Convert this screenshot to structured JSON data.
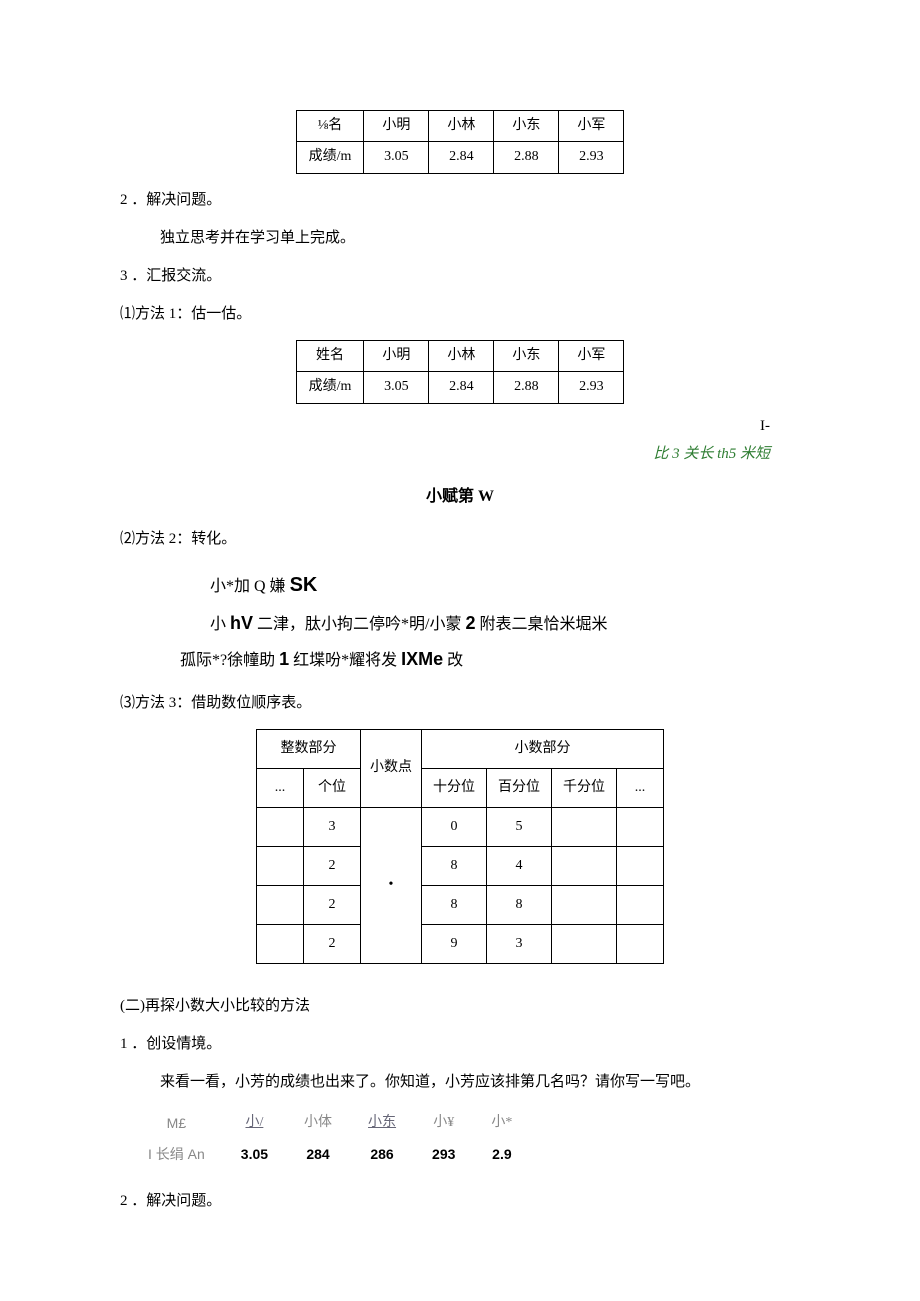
{
  "table1": {
    "headers": [
      "⅛名",
      "小明",
      "小林",
      "小东",
      "小军"
    ],
    "rowLabel": "成绩/m",
    "values": [
      "3.05",
      "2.84",
      "2.88",
      "2.93"
    ]
  },
  "sec2": "2 ．解决问题。",
  "sec2_sub": "独立思考并在学习单上完成。",
  "sec3": "3 ．汇报交流。",
  "m1": "⑴方法 1：估一估。",
  "table2": {
    "headers": [
      "姓名",
      "小明",
      "小林",
      "小东",
      "小军"
    ],
    "rowLabel": "成绩/m",
    "values": [
      "3.05",
      "2.84",
      "2.88",
      "2.93"
    ]
  },
  "note_i": "I-",
  "note_green": "比 3 关长 th5 米短",
  "center_title": "小赋第 W",
  "m2": "⑵方法 2：转化。",
  "m2_line1_a": "小*加 Q 嫌 ",
  "m2_line1_b": "SK",
  "m2_line2_a": "小 ",
  "m2_line2_b": "hV",
  "m2_line2_c": " 二津，肽小拘二停吟*明/小蒙 ",
  "m2_line2_d": "2",
  "m2_line2_e": " 附表二臬恰米堀米",
  "m2_line3_a": "孤际*?徐幢助 ",
  "m2_line3_b": "1",
  "m2_line3_c": " 红堞吩*耀将发 ",
  "m2_line3_d": "IXMe",
  "m2_line3_e": " 改",
  "m3": "⑶方法 3：借助数位顺序表。",
  "digit_table": {
    "int_label": "整数部分",
    "dot_label": "小数点",
    "frac_label": "小数部分",
    "ellipsis": "...",
    "ones_label": "个位",
    "dot": "•",
    "tenth_label": "十分位",
    "hund_label": "百分位",
    "thou_label": "千分位",
    "ellipsis2": "...",
    "rows": [
      [
        "",
        "3",
        "",
        "0",
        "5",
        "",
        ""
      ],
      [
        "",
        "2",
        "•",
        "8",
        "4",
        "",
        ""
      ],
      [
        "",
        "2",
        "",
        "8",
        "8",
        "",
        ""
      ],
      [
        "",
        "2",
        "",
        "9",
        "3",
        "",
        ""
      ]
    ]
  },
  "part2_title": "(二)再探小数大小比较的方法",
  "p2_s1": "1 ．创设情境。",
  "p2_s1_sub": "来看一看，小芳的成绩也出来了。你知道，小芳应该排第几名吗？请你写一写吧。",
  "rank": {
    "lbl1": "M£",
    "h": [
      "小/",
      "小体",
      "小东",
      "小¥",
      "小*"
    ],
    "lbl2": "I 长绢 An",
    "v": [
      "3.05",
      "284",
      "286",
      "293",
      "2.9"
    ]
  },
  "p2_s2": "2 ．解决问题。"
}
